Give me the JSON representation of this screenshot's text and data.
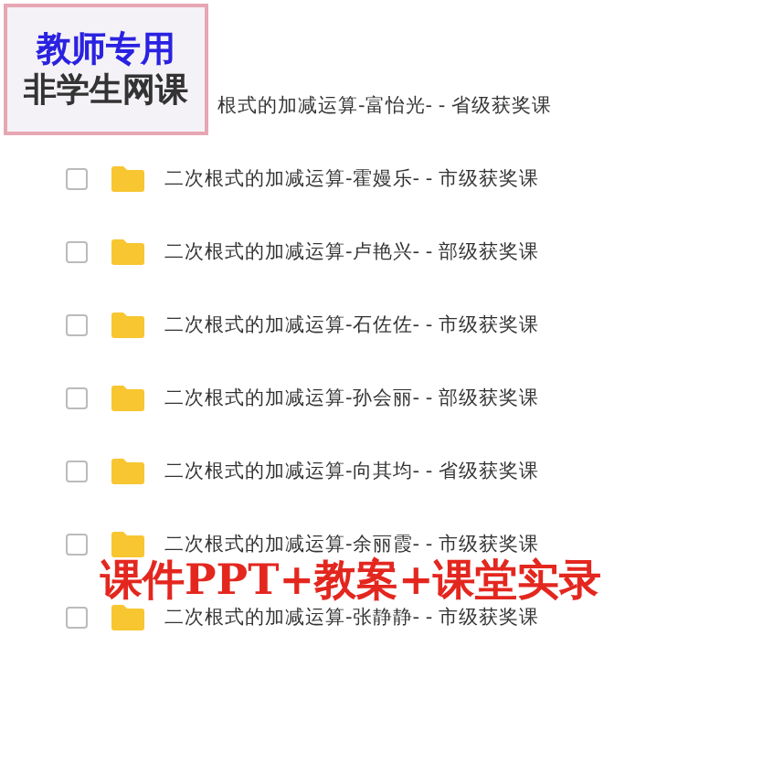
{
  "badge": {
    "line_1": "教师专用",
    "line_2": "非学生网课"
  },
  "files": [
    {
      "kind": "text_only",
      "name": "根式的加减运算-富怡光- - 省级获奖课"
    },
    {
      "kind": "file",
      "name": "二次根式的加减运算-霍嫚乐- - 市级获奖课",
      "checked": false
    },
    {
      "kind": "file",
      "name": "二次根式的加减运算-卢艳兴- - 部级获奖课",
      "checked": false
    },
    {
      "kind": "file",
      "name": "二次根式的加减运算-石佐佐- - 市级获奖课",
      "checked": false
    },
    {
      "kind": "file",
      "name": "二次根式的加减运算-孙会丽- - 部级获奖课",
      "checked": false
    },
    {
      "kind": "file",
      "name": "二次根式的加减运算-向其均- - 省级获奖课",
      "checked": false
    },
    {
      "kind": "file",
      "name": "二次根式的加减运算-余丽霞- - 市级获奖课",
      "checked": false
    },
    {
      "kind": "file",
      "name": "二次根式的加减运算-张静静- - 市级获奖课",
      "checked": false
    }
  ],
  "caption": "课件PPT+教案+课堂实录"
}
